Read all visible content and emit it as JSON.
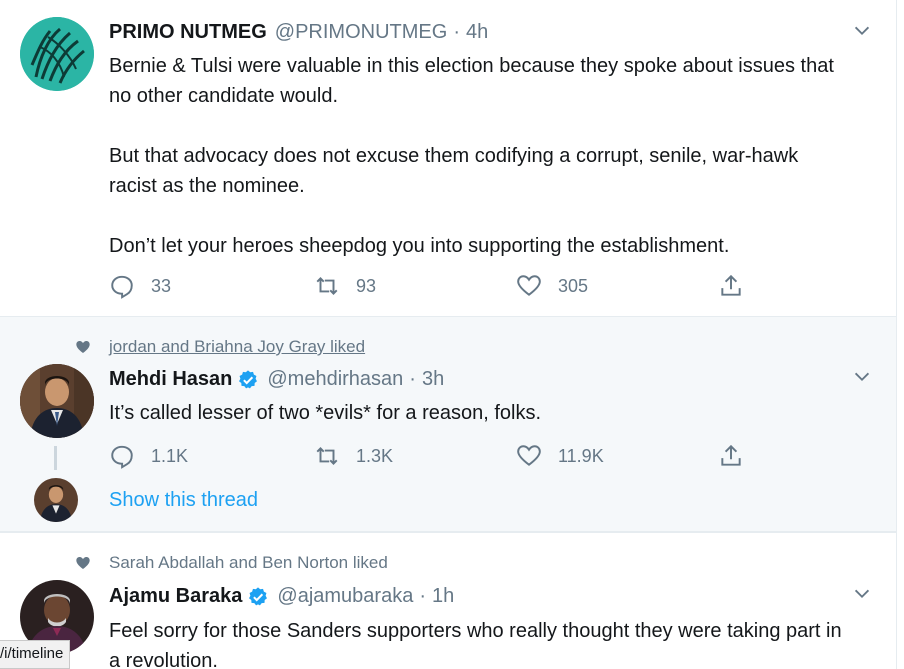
{
  "tweets": [
    {
      "name": "PRIMO NUTMEG",
      "handle": "@PRIMONUTMEG",
      "sep": "·",
      "time": "4h",
      "text": "Bernie & Tulsi were valuable in this election because they spoke about issues that no other candidate would.\n\nBut that advocacy does not excuse them codifying a corrupt, senile, war-hawk racist as the nominee.\n\nDon’t let your heroes sheepdog you into supporting the establishment.",
      "replies": "33",
      "retweets": "93",
      "likes": "305",
      "avatar_color": "#2bb5a5"
    },
    {
      "social_context": "jordan and Briahna Joy Gray liked",
      "name": "Mehdi Hasan",
      "handle": "@mehdirhasan",
      "sep": "·",
      "time": "3h",
      "text": "It’s called lesser of two *evils* for a reason, folks.",
      "replies": "1.1K",
      "retweets": "1.3K",
      "likes": "11.9K",
      "show_thread": "Show this thread"
    },
    {
      "social_context": "Sarah Abdallah and Ben Norton liked",
      "name": "Ajamu Baraka",
      "handle": "@ajamubaraka",
      "sep": "·",
      "time": "1h",
      "text": "Feel sorry for those Sanders supporters who really thought they were taking part in a revolution."
    }
  ],
  "status_url": "/i/timeline",
  "colors": {
    "accent": "#1da1f2",
    "secondary": "#657786",
    "hover_bg": "#f5f8fa"
  }
}
